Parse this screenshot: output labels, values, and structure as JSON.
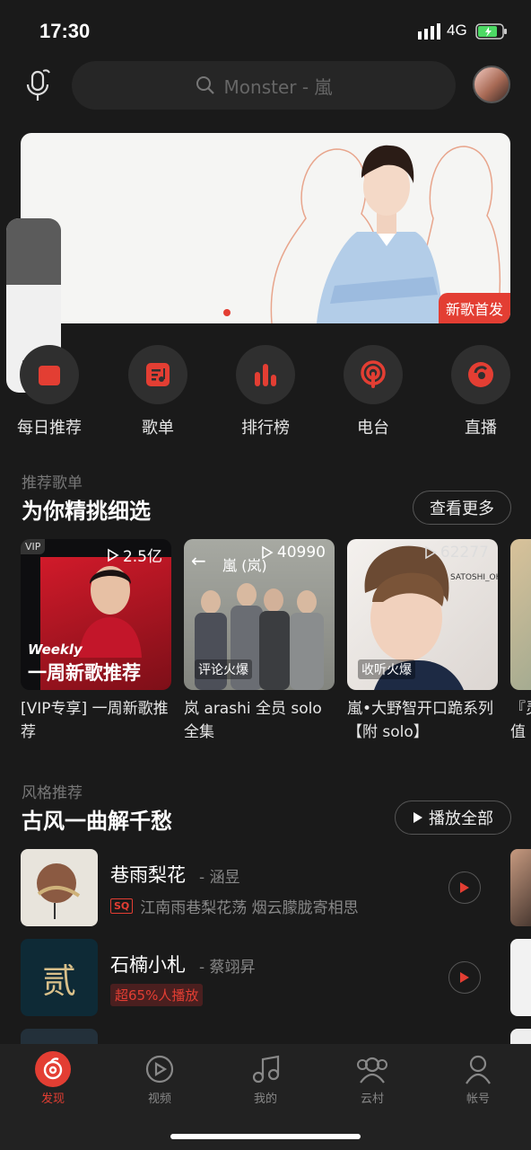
{
  "status": {
    "time": "17:30",
    "network": "4G"
  },
  "search": {
    "placeholder": "Monster - 嵐"
  },
  "banner": {
    "tag": "新歌首发"
  },
  "categories": [
    {
      "label": "每日推荐",
      "icon": "calendar-icon"
    },
    {
      "label": "歌单",
      "icon": "playlist-icon"
    },
    {
      "label": "排行榜",
      "icon": "chart-icon"
    },
    {
      "label": "电台",
      "icon": "radio-icon"
    },
    {
      "label": "直播",
      "icon": "live-icon"
    }
  ],
  "playlist_section": {
    "subtitle": "推荐歌单",
    "title": "为你精挑细选",
    "more_label": "查看更多",
    "cards": [
      {
        "vip": "VIP",
        "count": "2.5亿",
        "cover_text_small": "Weekly",
        "cover_text": "一周新歌推荐",
        "title": "[VIP专享] 一周新歌推荐"
      },
      {
        "count": "40990",
        "overlay_title": "嵐 (岚)",
        "hot": "评论火爆",
        "title": "岚 arashi 全员 solo 全集"
      },
      {
        "count": "62277",
        "hot": "收听火爆",
        "cover_small": "SATOSHI_OHNO",
        "title": "嵐•大野智开口跪系列【附 solo】"
      },
      {
        "title": "『灵值得"
      }
    ]
  },
  "style_section": {
    "subtitle": "风格推荐",
    "title": "古风一曲解千愁",
    "play_all_label": "播放全部",
    "songs": [
      {
        "title": "巷雨梨花",
        "artist": "- 涵昱",
        "badge": "SQ",
        "desc": "江南雨巷梨花荡 烟云朦胧寄相思"
      },
      {
        "title": "石楠小札",
        "artist": "- 蔡翊昇",
        "hot": "超65%人播放",
        "cover_text": "贰"
      }
    ]
  },
  "tabs": [
    {
      "label": "发现",
      "icon": "discover-icon",
      "active": true
    },
    {
      "label": "视频",
      "icon": "video-icon"
    },
    {
      "label": "我的",
      "icon": "music-note-icon"
    },
    {
      "label": "云村",
      "icon": "community-icon"
    },
    {
      "label": "帐号",
      "icon": "account-icon"
    }
  ],
  "colors": {
    "accent": "#e33e33",
    "background": "#1a1a1a"
  }
}
